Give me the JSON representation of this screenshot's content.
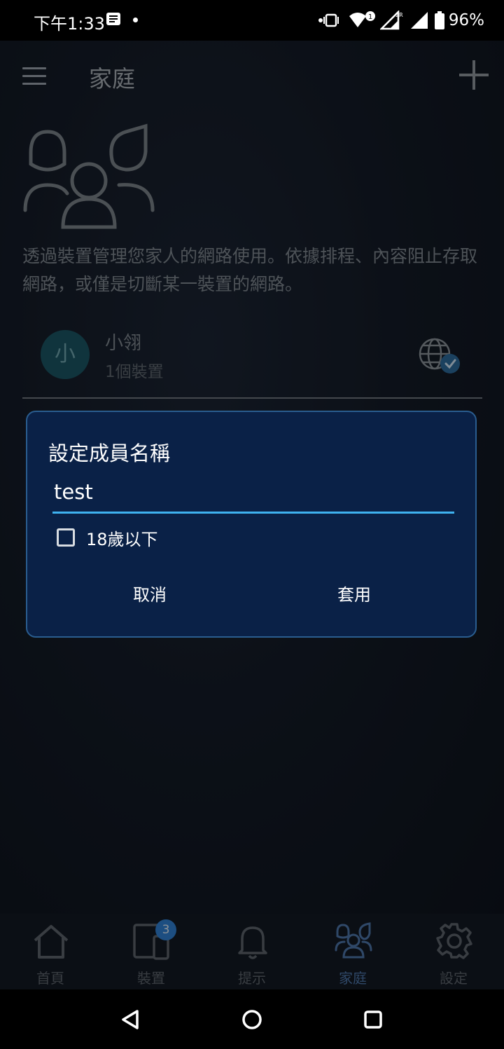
{
  "status_bar": {
    "time": "下午1:33",
    "battery": "96%"
  },
  "header": {
    "title": "家庭"
  },
  "intro": {
    "description": "透過裝置管理您家人的網路使用。依據排程、內容阻止存取網路，或僅是切斷某一裝置的網路。"
  },
  "member": {
    "avatar_initial": "小",
    "name": "小翎",
    "devices": "1個裝置"
  },
  "dialog": {
    "title": "設定成員名稱",
    "name_value": "test",
    "checkbox_label": "18歲以下",
    "checkbox_checked": false,
    "cancel_label": "取消",
    "apply_label": "套用"
  },
  "bottom_nav": {
    "home": "首頁",
    "devices": "裝置",
    "devices_badge": "3",
    "alerts": "提示",
    "family": "家庭",
    "settings": "設定",
    "active": "family"
  },
  "colors": {
    "dialog_bg": "#0a2147",
    "accent": "#3fb2f0",
    "badge": "#2f7fd0"
  }
}
